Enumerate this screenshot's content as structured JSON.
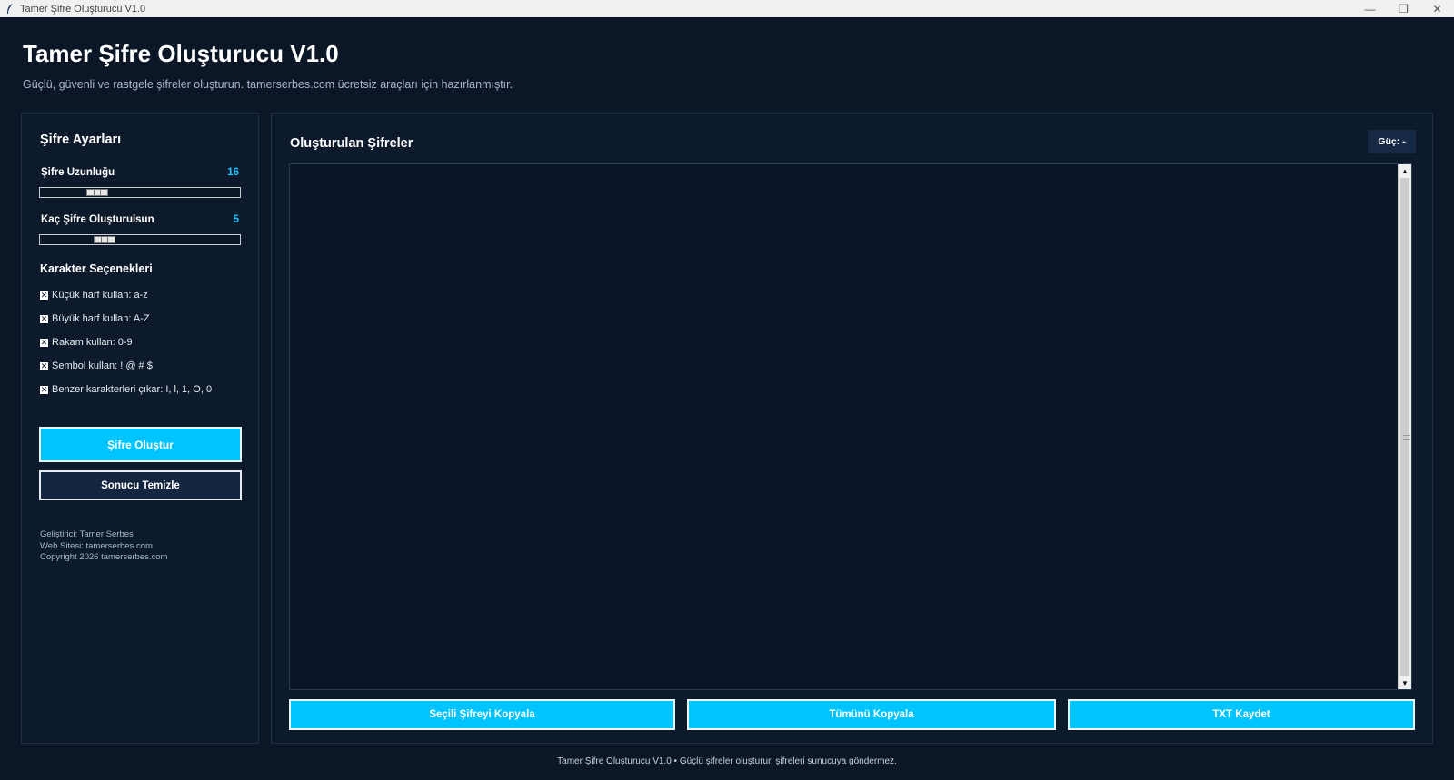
{
  "window": {
    "title": "Tamer Şifre Oluşturucu V1.0",
    "minimize_glyph": "—",
    "maximize_glyph": "❐",
    "close_glyph": "✕",
    "icon": "feather-icon"
  },
  "header": {
    "title": "Tamer Şifre Oluşturucu V1.0",
    "subtitle": "Güçlü, güvenli ve rastgele şifreler oluşturun. tamerserbes.com ücretsiz araçları için hazırlanmıştır."
  },
  "settings": {
    "heading": "Şifre Ayarları",
    "length": {
      "label": "Şifre Uzunluğu",
      "value": "16",
      "fraction": 0.2
    },
    "count": {
      "label": "Kaç Şifre Oluşturulsun",
      "value": "5",
      "fraction": 0.24
    },
    "char_heading": "Karakter Seçenekleri",
    "options": [
      {
        "label": "Küçük harf kullan: a-z",
        "checked": true
      },
      {
        "label": "Büyük harf kullan: A-Z",
        "checked": true
      },
      {
        "label": "Rakam kullan: 0-9",
        "checked": true
      },
      {
        "label": "Sembol kullan: ! @ # $",
        "checked": true
      },
      {
        "label": "Benzer karakterleri çıkar: I, l, 1, O, 0",
        "checked": true
      }
    ],
    "check_mark": "✕",
    "generate_label": "Şifre Oluştur",
    "clear_label": "Sonucu Temizle",
    "info": {
      "developer": "Geliştirici: Tamer Serbes",
      "website": "Web Sitesi: tamerserbes.com",
      "copyright": "Copyright 2026 tamerserbes.com"
    }
  },
  "output": {
    "heading": "Oluşturulan Şifreler",
    "strength": "Güç: -",
    "scroll_up": "▲",
    "scroll_down": "▼",
    "copy_selected_label": "Seçili Şifreyi Kopyala",
    "copy_all_label": "Tümünü Kopyala",
    "save_txt_label": "TXT Kaydet"
  },
  "status_bar": "Tamer Şifre Oluşturucu V1.0  •  Güçlü şifreler oluşturur, şifreleri sunucuya göndermez.",
  "colors": {
    "background": "#0b1626",
    "panel": "#0d1a2b",
    "accent": "#00c4ff",
    "value_text": "#18c3ff"
  }
}
